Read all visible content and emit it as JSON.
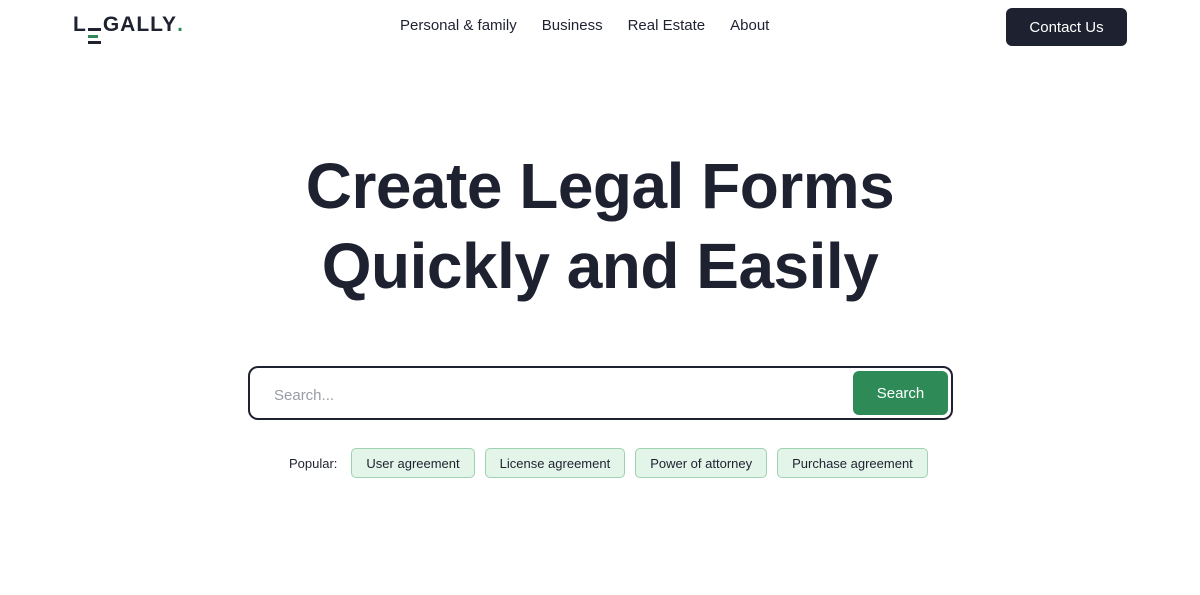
{
  "brand": {
    "logo_prefix": "L",
    "logo_suffix": "GALLY",
    "logo_dot": "."
  },
  "nav": {
    "items": [
      {
        "label": "Personal & family"
      },
      {
        "label": "Business"
      },
      {
        "label": "Real Estate"
      },
      {
        "label": "About"
      }
    ]
  },
  "header": {
    "contact_label": "Contact Us"
  },
  "hero": {
    "title_line1": "Create Legal Forms",
    "title_line2": "Quickly and Easily"
  },
  "search": {
    "placeholder": "Search...",
    "button_label": "Search"
  },
  "popular": {
    "label": "Popular:",
    "chips": [
      {
        "label": "User agreement"
      },
      {
        "label": "License agreement"
      },
      {
        "label": "Power of attorney"
      },
      {
        "label": "Purchase agreement"
      }
    ]
  },
  "colors": {
    "text_dark": "#1e2130",
    "accent_green": "#2e8b57",
    "chip_bg": "#e3f4e8",
    "chip_border": "#9fd2b0"
  }
}
